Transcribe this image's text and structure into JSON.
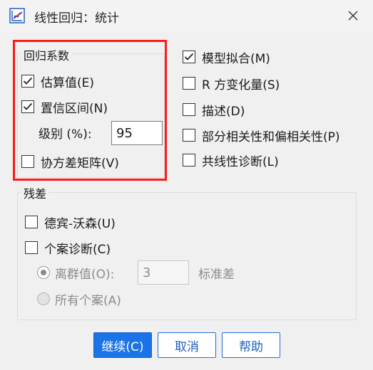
{
  "window": {
    "title": "线性回归：统计",
    "icon": "regression-icon",
    "close_icon": "close-icon"
  },
  "coefficients_group": {
    "legend": "回归系数",
    "estimates": {
      "label": "估算值(E)",
      "checked": true
    },
    "confidence_intervals": {
      "label": "置信区间(N)",
      "checked": true
    },
    "level_label": "级别 (%):",
    "level_value": "95",
    "covariance_matrix": {
      "label": "协方差矩阵(V)",
      "checked": false
    }
  },
  "right_options": {
    "model_fit": {
      "label": "模型拟合(M)",
      "checked": true
    },
    "r_squared_change": {
      "label": "R 方变化量(S)",
      "checked": false
    },
    "descriptives": {
      "label": "描述(D)",
      "checked": false
    },
    "part_partial": {
      "label": "部分相关性和偏相关性(P)",
      "checked": false
    },
    "collinearity": {
      "label": "共线性诊断(L)",
      "checked": false
    }
  },
  "residuals_group": {
    "legend": "残差",
    "durbin_watson": {
      "label": "德宾-沃森(U)",
      "checked": false
    },
    "casewise": {
      "label": "个案诊断(C)",
      "checked": false
    },
    "outliers": {
      "label": "离群值(O):",
      "selected": true,
      "enabled": false
    },
    "outliers_value": "3",
    "outliers_unit": "标准差",
    "all_cases": {
      "label": "所有个案(A)",
      "selected": false,
      "enabled": false
    }
  },
  "buttons": {
    "continue": "继续(C)",
    "cancel": "取消",
    "help": "帮助"
  },
  "colors": {
    "highlight": "#ff1a1a",
    "primary": "#1a73e8"
  }
}
